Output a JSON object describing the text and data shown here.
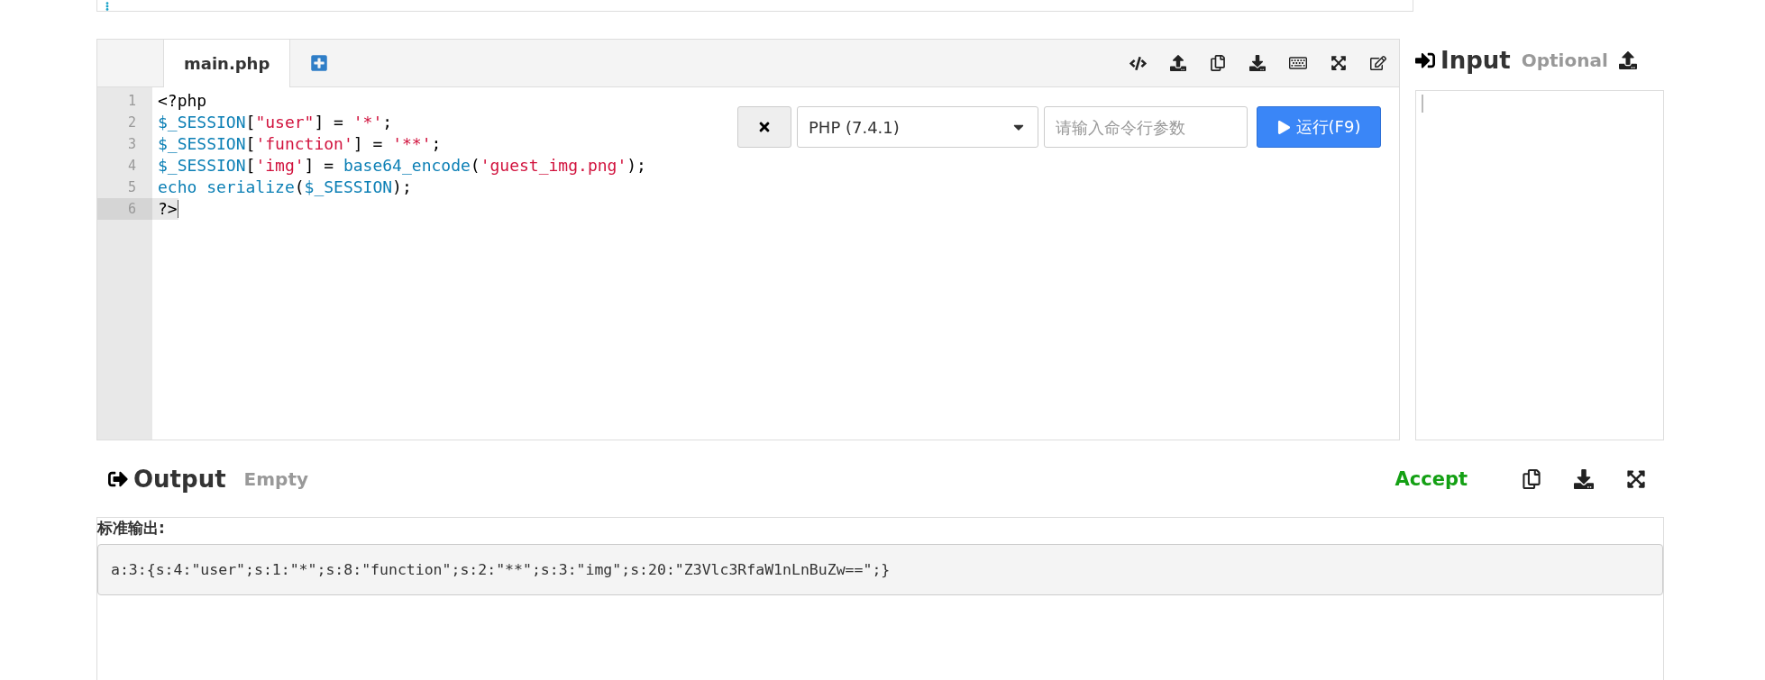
{
  "editor": {
    "tabs": [
      {
        "label": "main.php",
        "selected": true
      }
    ],
    "lines": [
      {
        "number": "1",
        "active": false,
        "tokens": [
          {
            "kind": "plain",
            "text": "<?php"
          }
        ]
      },
      {
        "number": "2",
        "active": false,
        "tokens": [
          {
            "kind": "var",
            "text": "$_SESSION"
          },
          {
            "kind": "plain",
            "text": "["
          },
          {
            "kind": "string",
            "text": "\"user\""
          },
          {
            "kind": "plain",
            "text": "] = "
          },
          {
            "kind": "string",
            "text": "'*'"
          },
          {
            "kind": "plain",
            "text": ";"
          }
        ]
      },
      {
        "number": "3",
        "active": false,
        "tokens": [
          {
            "kind": "var",
            "text": "$_SESSION"
          },
          {
            "kind": "plain",
            "text": "["
          },
          {
            "kind": "string",
            "text": "'function'"
          },
          {
            "kind": "plain",
            "text": "] = "
          },
          {
            "kind": "string",
            "text": "'**'"
          },
          {
            "kind": "plain",
            "text": ";"
          }
        ]
      },
      {
        "number": "4",
        "active": false,
        "tokens": [
          {
            "kind": "var",
            "text": "$_SESSION"
          },
          {
            "kind": "plain",
            "text": "["
          },
          {
            "kind": "string",
            "text": "'img'"
          },
          {
            "kind": "plain",
            "text": "] = "
          },
          {
            "kind": "var",
            "text": "base64_encode"
          },
          {
            "kind": "plain",
            "text": "("
          },
          {
            "kind": "string",
            "text": "'guest_img.png'"
          },
          {
            "kind": "plain",
            "text": ");"
          }
        ]
      },
      {
        "number": "5",
        "active": false,
        "tokens": [
          {
            "kind": "var",
            "text": "echo serialize"
          },
          {
            "kind": "plain",
            "text": "("
          },
          {
            "kind": "var",
            "text": "$_SESSION"
          },
          {
            "kind": "plain",
            "text": ");"
          }
        ]
      },
      {
        "number": "6",
        "active": true,
        "tokens": [
          {
            "kind": "plain",
            "text": "?>"
          }
        ]
      }
    ],
    "language": "PHP (7.4.1)",
    "args_placeholder": "请输入命令行参数",
    "run_label": "运行(F9)"
  },
  "input": {
    "title": "Input",
    "hint": "Optional"
  },
  "output": {
    "title": "Output",
    "status": "Empty",
    "verdict": "Accept",
    "stdout_label": "标准输出:",
    "stdout": "a:3:{s:4:\"user\";s:1:\"*\";s:8:\"function\";s:2:\"**\";s:3:\"img\";s:20:\"Z3Vlc3RfaW1nLnBuZw==\";}"
  }
}
